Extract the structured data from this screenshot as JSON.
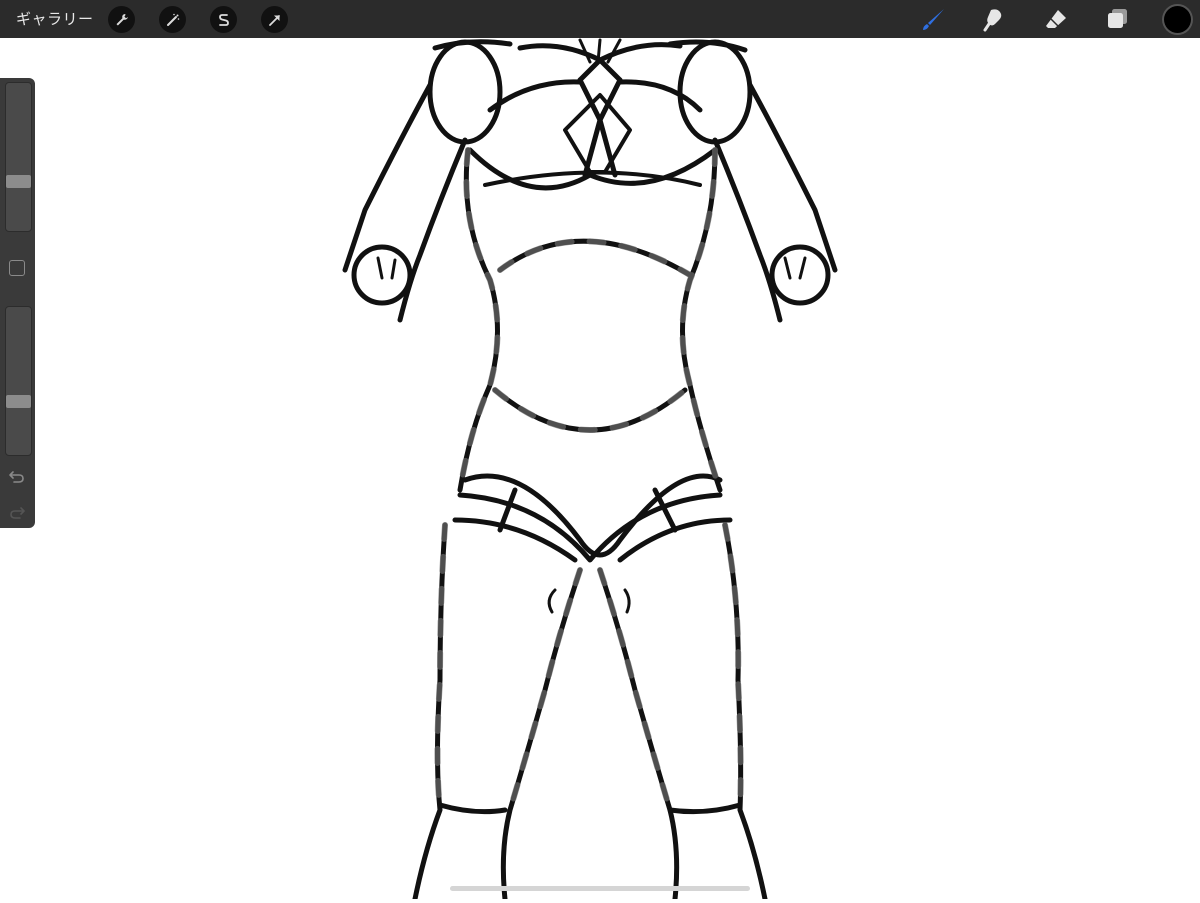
{
  "topbar": {
    "gallery_label": "ギャラリー",
    "left_tools": [
      "wrench-icon",
      "magic-wand-icon",
      "selection-icon",
      "transform-arrow-icon"
    ],
    "right_tools": [
      "brush-icon",
      "smudge-icon",
      "eraser-icon",
      "layers-icon"
    ],
    "active_tool": "brush",
    "accent_color": "#2f6fe0",
    "current_color": "#000000"
  },
  "sidebar": {
    "brush_size_level": 0.32,
    "opacity_level": 0.35,
    "icons": [
      "modify-square-icon",
      "undo-icon",
      "redo-icon"
    ]
  }
}
